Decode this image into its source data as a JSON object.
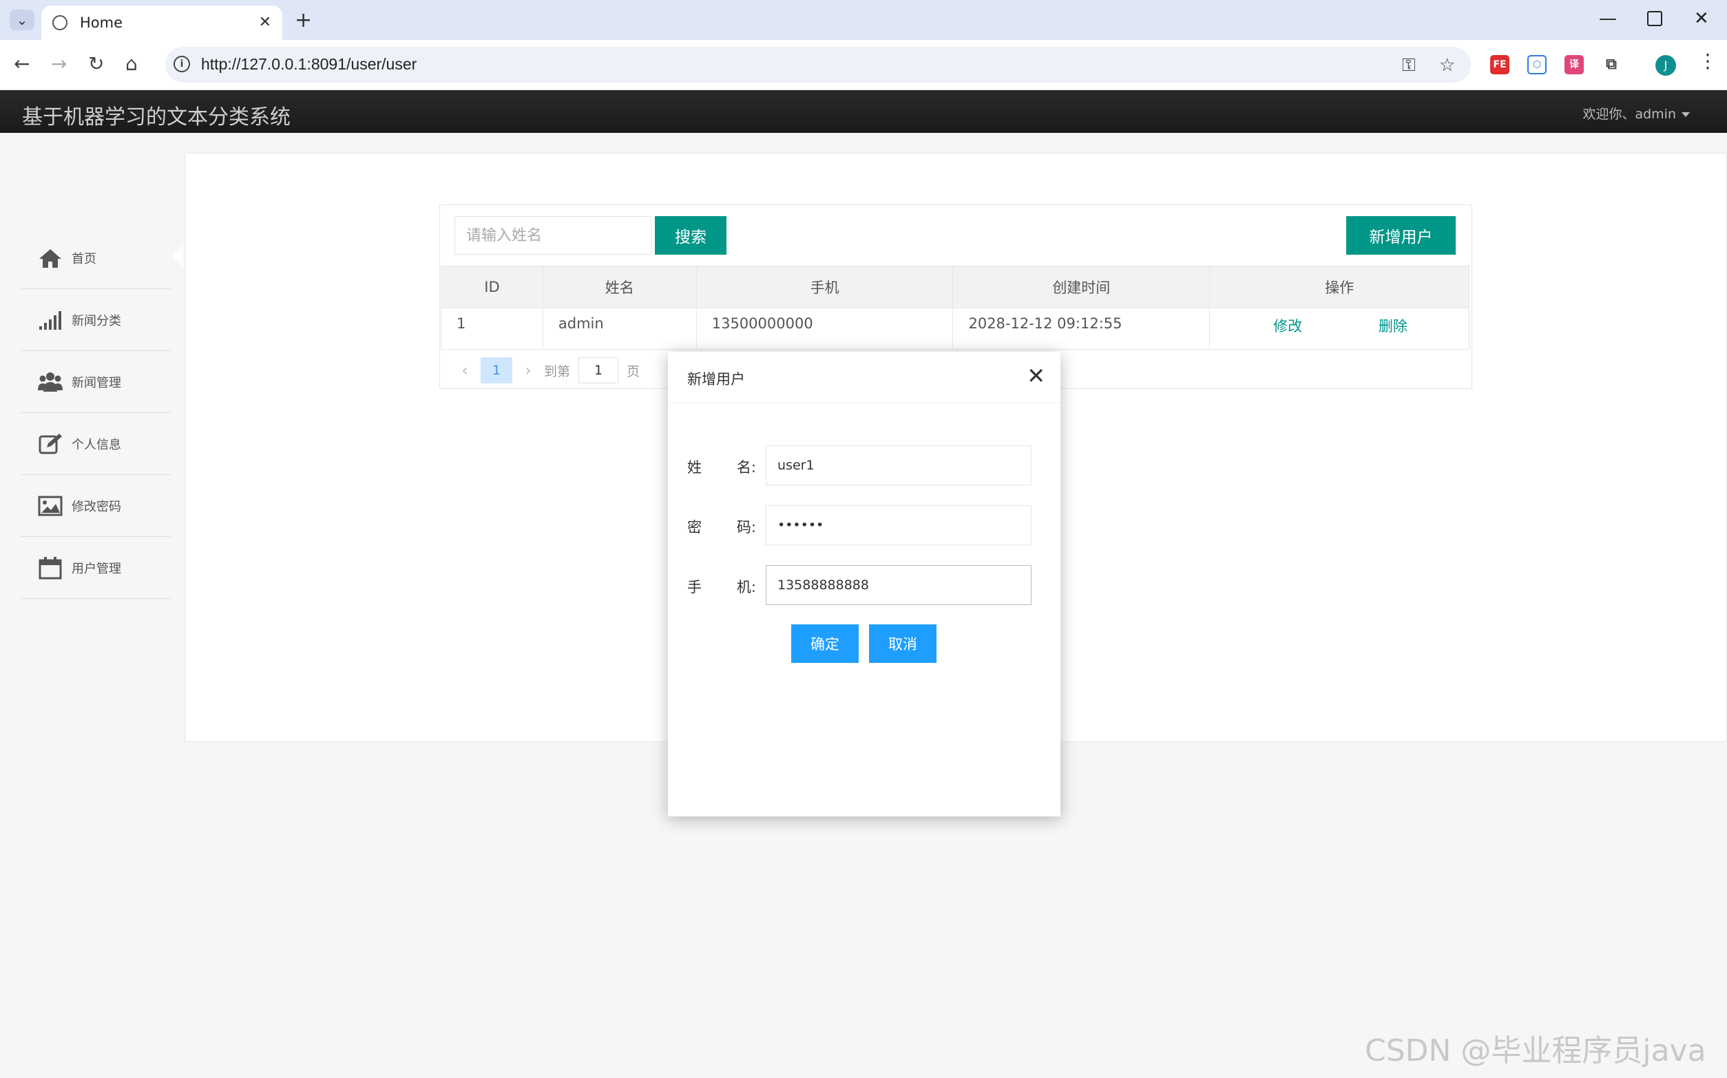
{
  "browser": {
    "tab_title": "Home",
    "url": "http://127.0.0.1:8091/user/user",
    "avatar_letter": "J"
  },
  "app": {
    "title": "基于机器学习的文本分类系统",
    "welcome": "欢迎你、admin"
  },
  "sidebar": {
    "items": [
      {
        "label": "首页",
        "icon": "home-icon"
      },
      {
        "label": "新闻分类",
        "icon": "signal-bars-icon"
      },
      {
        "label": "新闻管理",
        "icon": "users-icon"
      },
      {
        "label": "个人信息",
        "icon": "edit-icon"
      },
      {
        "label": "修改密码",
        "icon": "image-icon"
      },
      {
        "label": "用户管理",
        "icon": "calendar-icon"
      }
    ]
  },
  "search": {
    "placeholder": "请输入姓名",
    "button_label": "搜索",
    "add_button_label": "新增用户"
  },
  "table": {
    "columns": [
      "ID",
      "姓名",
      "手机",
      "创建时间",
      "操作"
    ],
    "rows": [
      {
        "id": "1",
        "name": "admin",
        "phone": "13500000000",
        "created": "2028-12-12 09:12:55",
        "edit": "修改",
        "delete": "删除"
      }
    ]
  },
  "pager": {
    "current": "1",
    "goto_label": "到第",
    "goto_value": "1",
    "page_unit": "页"
  },
  "modal": {
    "title": "新增用户",
    "fields": [
      {
        "label_a": "姓",
        "label_b": "名:",
        "value": "user1"
      },
      {
        "label_a": "密",
        "label_b": "码:",
        "value": "••••••"
      },
      {
        "label_a": "手",
        "label_b": "机:",
        "value": "13588888888"
      }
    ],
    "confirm_label": "确定",
    "cancel_label": "取消"
  },
  "watermark": "CSDN @毕业程序员java",
  "colors": {
    "accent_teal": "#009688",
    "accent_blue": "#1e9fff",
    "header_bg": "#1a1a1a"
  }
}
